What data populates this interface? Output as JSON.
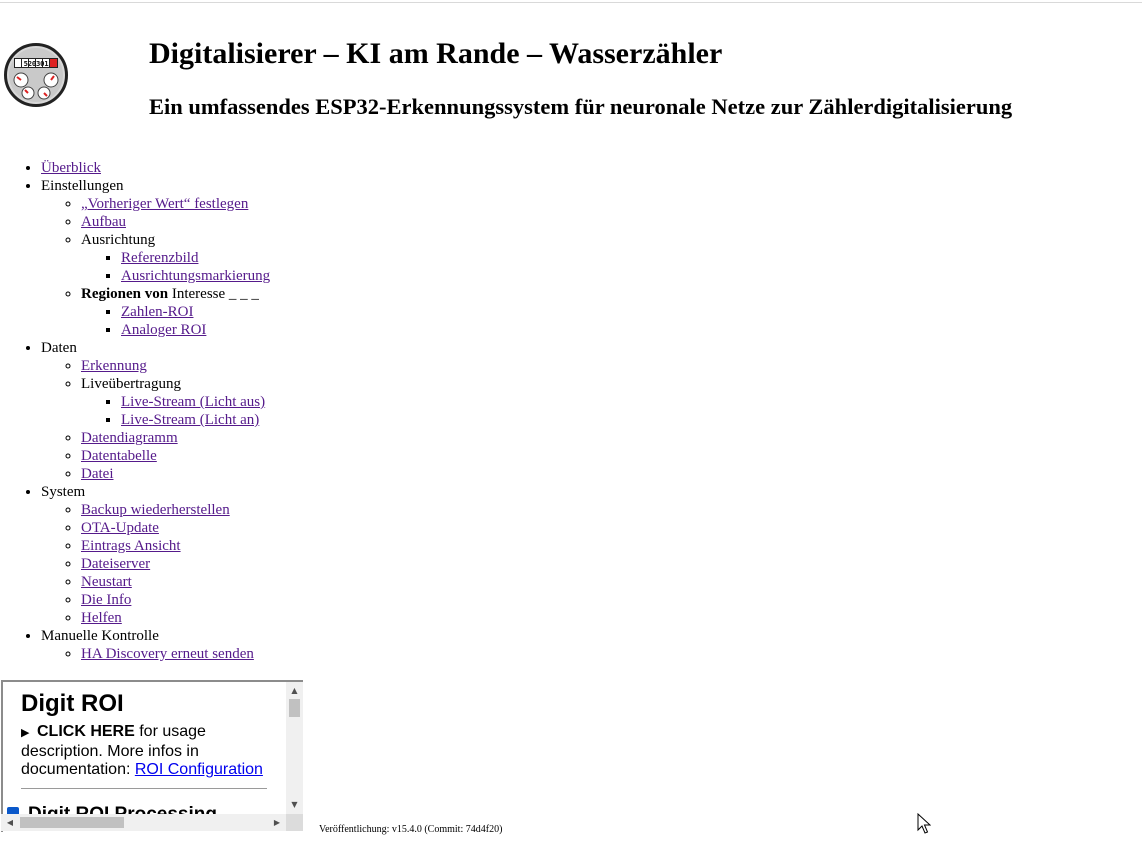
{
  "header": {
    "title": "Digitalisierer – KI am Rande – Wasserzähler",
    "subtitle": "Ein umfassendes ESP32-Erkennungssystem für neuronale Netze zur Zählerdigitalisierung",
    "logo_digits": "520301"
  },
  "menu": {
    "overview": "Überblick",
    "settings": {
      "label": "Einstellungen",
      "prev_value": "„Vorheriger Wert“ festlegen",
      "setup": "Aufbau",
      "alignment": {
        "label": "Ausrichtung",
        "reference_image": "Referenzbild",
        "alignment_marker": "Ausrichtungsmarkierung"
      },
      "roi": {
        "label_bold": "Regionen von",
        "label_rest": " Interesse _ _ _",
        "digit_roi": "Zahlen-ROI",
        "analog_roi": "Analoger ROI"
      }
    },
    "data": {
      "label": "Daten",
      "recognition": "Erkennung",
      "live": {
        "label": "Liveübertragung",
        "stream_off": "Live-Stream (Licht aus)",
        "stream_on": "Live-Stream (Licht an)"
      },
      "chart": "Datendiagramm",
      "table": "Datentabelle",
      "file": "Datei"
    },
    "system": {
      "label": "System",
      "backup": "Backup wiederherstellen",
      "ota": "OTA-Update",
      "log": "Eintrags Ansicht",
      "fileserver": "Dateiserver",
      "reboot": "Neustart",
      "info": "Die Info",
      "help": "Helfen"
    },
    "manual": {
      "label": "Manuelle Kontrolle",
      "ha_discovery": "HA Discovery erneut senden"
    }
  },
  "frame": {
    "heading": "Digit ROI",
    "click_here": "CLICK HERE",
    "desc_rest": " for usage description. More infos in documentation: ",
    "doc_link": "ROI Configuration",
    "processing_label": "Digit ROI Processing",
    "processing_checked": true
  },
  "footer": {
    "release": "Veröffentlichung: v15.4.0 (Commit: 74d4f20)"
  }
}
